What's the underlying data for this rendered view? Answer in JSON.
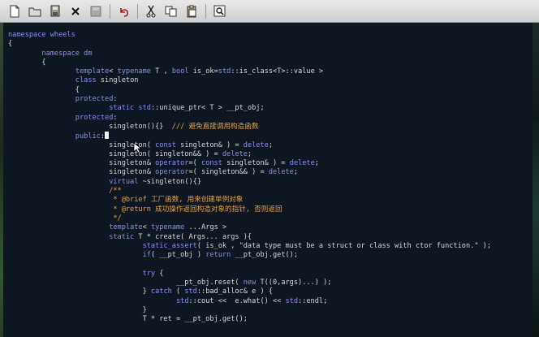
{
  "toolbar": {
    "buttons": [
      {
        "icon": "new-file-icon"
      },
      {
        "icon": "open-folder-icon"
      },
      {
        "icon": "save-icon"
      },
      {
        "icon": "close-icon"
      },
      {
        "icon": "save-disabled-icon"
      },
      {
        "icon": "undo-icon"
      },
      {
        "icon": "cut-icon"
      },
      {
        "icon": "copy-icon"
      },
      {
        "icon": "paste-icon"
      },
      {
        "icon": "find-icon"
      }
    ]
  },
  "colors": {
    "keyword": "#8a8ff0",
    "text": "#d8d8d8",
    "string": "#e8e8e8",
    "comment": "#e8a040",
    "std": "#8a8ff0",
    "background": "#0e1621"
  },
  "code": {
    "lines": [
      [
        [
          "k",
          "namespace wheels"
        ]
      ],
      [
        [
          "t",
          "{"
        ]
      ],
      [
        [
          "t",
          "        "
        ],
        [
          "k",
          "namespace dm"
        ]
      ],
      [
        [
          "t",
          "        {"
        ]
      ],
      [
        [
          "t",
          "                "
        ],
        [
          "k",
          "template"
        ],
        [
          "t",
          "< "
        ],
        [
          "k",
          "typename"
        ],
        [
          "t",
          " T , "
        ],
        [
          "k",
          "bool"
        ],
        [
          "t",
          " is_ok="
        ],
        [
          "k",
          "std"
        ],
        [
          "t",
          "::is_class<T>::value >"
        ]
      ],
      [
        [
          "t",
          "                "
        ],
        [
          "k",
          "class"
        ],
        [
          "t",
          " singleton"
        ]
      ],
      [
        [
          "t",
          "                {"
        ]
      ],
      [
        [
          "t",
          "                "
        ],
        [
          "k",
          "protected"
        ],
        [
          "t",
          ":"
        ]
      ],
      [
        [
          "t",
          "                        "
        ],
        [
          "k",
          "static"
        ],
        [
          "t",
          " "
        ],
        [
          "k",
          "std"
        ],
        [
          "t",
          "::unique_ptr< T > __pt_obj;"
        ]
      ],
      [
        [
          "t",
          "                "
        ],
        [
          "k",
          "protected"
        ],
        [
          "t",
          ":"
        ]
      ],
      [
        [
          "t",
          "                        singleton(){}  "
        ],
        [
          "c",
          "/// 避免直接调用构造函数"
        ]
      ],
      [
        [
          "t",
          "                "
        ],
        [
          "k",
          "public"
        ],
        [
          "t",
          ":"
        ],
        [
          "caret",
          ""
        ]
      ],
      [
        [
          "t",
          "                        singleton( "
        ],
        [
          "k",
          "const"
        ],
        [
          "t",
          " singleton& ) = "
        ],
        [
          "k",
          "delete"
        ],
        [
          "t",
          ";"
        ]
      ],
      [
        [
          "t",
          "                        singleton( singleton&& ) = "
        ],
        [
          "k",
          "delete"
        ],
        [
          "t",
          ";"
        ]
      ],
      [
        [
          "t",
          "                        singleton& "
        ],
        [
          "k",
          "operator"
        ],
        [
          "t",
          "=( "
        ],
        [
          "k",
          "const"
        ],
        [
          "t",
          " singleton& ) = "
        ],
        [
          "k",
          "delete"
        ],
        [
          "t",
          ";"
        ]
      ],
      [
        [
          "t",
          "                        singleton& "
        ],
        [
          "k",
          "operator"
        ],
        [
          "t",
          "=( singleton&& ) = "
        ],
        [
          "k",
          "delete"
        ],
        [
          "t",
          ";"
        ]
      ],
      [
        [
          "t",
          "                        "
        ],
        [
          "k",
          "virtual"
        ],
        [
          "t",
          " ~singleton(){}"
        ]
      ],
      [
        [
          "t",
          "                        "
        ],
        [
          "c",
          "/**"
        ]
      ],
      [
        [
          "t",
          "                        "
        ],
        [
          "c",
          " * @brief 工厂函数, 用来创建单例对象"
        ]
      ],
      [
        [
          "t",
          "                        "
        ],
        [
          "c",
          " * @return 成功操作返回构造对象的指针, 否则返回"
        ]
      ],
      [
        [
          "t",
          "                        "
        ],
        [
          "c",
          " */"
        ]
      ],
      [
        [
          "t",
          "                        "
        ],
        [
          "k",
          "template"
        ],
        [
          "t",
          "< "
        ],
        [
          "k",
          "typename"
        ],
        [
          "t",
          " ...Args >"
        ]
      ],
      [
        [
          "t",
          "                        "
        ],
        [
          "k",
          "static"
        ],
        [
          "t",
          " T * create( Args... args ){"
        ]
      ],
      [
        [
          "t",
          "                                "
        ],
        [
          "k",
          "static_assert"
        ],
        [
          "t",
          "( is_ok , \"data type must be a struct or class with ctor function.\" );"
        ]
      ],
      [
        [
          "t",
          "                                "
        ],
        [
          "k",
          "if"
        ],
        [
          "t",
          "( __pt_obj ) "
        ],
        [
          "k",
          "return"
        ],
        [
          "t",
          " __pt_obj.get();"
        ]
      ],
      [
        [
          "t",
          ""
        ]
      ],
      [
        [
          "t",
          "                                "
        ],
        [
          "k",
          "try"
        ],
        [
          "t",
          " {"
        ]
      ],
      [
        [
          "t",
          "                                        __pt_obj.reset( "
        ],
        [
          "k",
          "new"
        ],
        [
          "t",
          " T((0,args)...) );"
        ]
      ],
      [
        [
          "t",
          "                                } "
        ],
        [
          "k",
          "catch"
        ],
        [
          "t",
          " ( "
        ],
        [
          "k",
          "std"
        ],
        [
          "t",
          "::bad_alloc& e ) {"
        ]
      ],
      [
        [
          "t",
          "                                        "
        ],
        [
          "k",
          "std"
        ],
        [
          "t",
          "::cout <<  e.what() << "
        ],
        [
          "k",
          "std"
        ],
        [
          "t",
          "::endl;"
        ]
      ],
      [
        [
          "t",
          "                                }"
        ]
      ],
      [
        [
          "t",
          "                                T * ret = __pt_obj.get();"
        ]
      ]
    ]
  }
}
